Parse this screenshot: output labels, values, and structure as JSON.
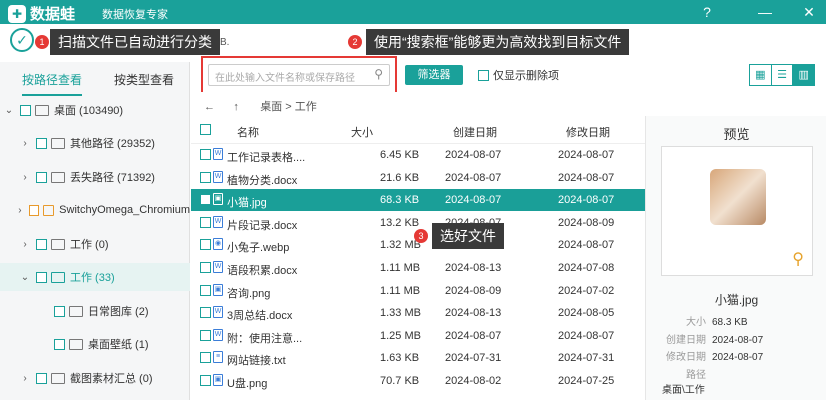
{
  "app": {
    "logo_text": "数据蛙",
    "subtitle": "数据恢复专家",
    "help_icon": "?",
    "minimize_icon": "—",
    "close_icon": "✕"
  },
  "toolbar": {
    "scan_tail": "B.",
    "search_placeholder": "在此处输入文件名称或保存路径",
    "filter_label": "筛选器",
    "deleted_only_label": "仅显示删除项",
    "view_modes": [
      "grid-icon",
      "list-icon",
      "detail-icon"
    ]
  },
  "annotations": [
    {
      "num": "1",
      "text": "扫描文件已自动进行分类"
    },
    {
      "num": "2",
      "text": "使用“搜索框”能够更为高效找到目标文件"
    },
    {
      "num": "3",
      "text": "选好文件"
    }
  ],
  "sidebar": {
    "tabs": [
      "按路径查看",
      "按类型查看"
    ],
    "items": [
      {
        "label": "桌面 (103490)",
        "arrow": "⌄",
        "level": 0
      },
      {
        "label": "其他路径 (29352)",
        "arrow": "›",
        "level": 1
      },
      {
        "label": "丢失路径 (71392)",
        "arrow": "›",
        "level": 1
      },
      {
        "label": "SwitchyOmega_Chromium",
        "arrow": "›",
        "level": 1
      },
      {
        "label": "工作 (0)",
        "arrow": "›",
        "level": 1
      },
      {
        "label": "工作 (33)",
        "arrow": "⌄",
        "level": 1
      },
      {
        "label": "日常图库 (2)",
        "arrow": "",
        "level": 2
      },
      {
        "label": "桌面壁纸 (1)",
        "arrow": "",
        "level": 2
      },
      {
        "label": "截图素材汇总 (0)",
        "arrow": "›",
        "level": 1
      }
    ]
  },
  "breadcrumb": {
    "back_icon": "←",
    "up_icon": "↑",
    "path": "桌面 > 工作"
  },
  "file_list": {
    "headers": [
      "名称",
      "大小",
      "创建日期",
      "修改日期"
    ],
    "rows": [
      {
        "name": "工作记录表格....",
        "size": "6.45 KB",
        "created": "2024-08-07",
        "modified": "2024-08-07",
        "icon": "W"
      },
      {
        "name": "植物分类.docx",
        "size": "21.6 KB",
        "created": "2024-08-07",
        "modified": "2024-08-07",
        "icon": "W"
      },
      {
        "name": "小猫.jpg",
        "size": "68.3 KB",
        "created": "2024-08-07",
        "modified": "2024-08-07",
        "icon": "▣"
      },
      {
        "name": "片段记录.docx",
        "size": "13.2 KB",
        "created": "2024-08-07",
        "modified": "2024-08-09",
        "icon": "W"
      },
      {
        "name": "小兔子.webp",
        "size": "1.32 MB",
        "created": "2024-08-07",
        "modified": "2024-08-07",
        "icon": "◉"
      },
      {
        "name": "语段积累.docx",
        "size": "1.11 MB",
        "created": "2024-08-13",
        "modified": "2024-07-08",
        "icon": "W"
      },
      {
        "name": "咨询.png",
        "size": "1.11 MB",
        "created": "2024-08-09",
        "modified": "2024-07-02",
        "icon": "▣"
      },
      {
        "name": "3周总结.docx",
        "size": "1.33 MB",
        "created": "2024-08-13",
        "modified": "2024-08-05",
        "icon": "W"
      },
      {
        "name": "附：使用注意...",
        "size": "1.25 MB",
        "created": "2024-08-07",
        "modified": "2024-08-07",
        "icon": "W"
      },
      {
        "name": "网站链接.txt",
        "size": "1.63 KB",
        "created": "2024-07-31",
        "modified": "2024-07-31",
        "icon": "≡"
      },
      {
        "name": "U盘.png",
        "size": "70.7 KB",
        "created": "2024-08-02",
        "modified": "2024-07-25",
        "icon": "▣"
      }
    ]
  },
  "preview": {
    "title": "预览",
    "filename": "小猫.jpg",
    "meta": [
      {
        "k": "大小",
        "v": "68.3 KB"
      },
      {
        "k": "创建日期",
        "v": "2024-08-07"
      },
      {
        "k": "修改日期",
        "v": "2024-08-07"
      },
      {
        "k": "路径",
        "v": "桌面\\工作"
      }
    ],
    "zoom_icon": "⚲"
  },
  "colors": {
    "accent": "#1aa19a",
    "annotation_red": "#e53935",
    "tooltip_bg": "#3a3a3a"
  }
}
